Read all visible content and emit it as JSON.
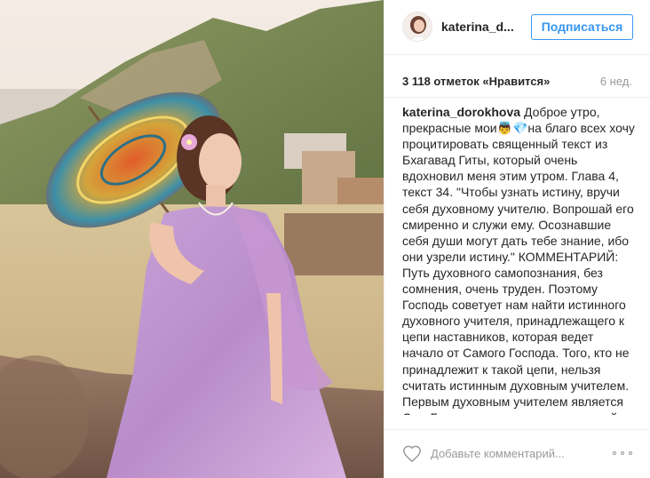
{
  "header": {
    "username": "katerina_d...",
    "follow_label": "Подписаться"
  },
  "meta": {
    "likes": "3 118 отметок «Нравится»",
    "age": "6 нед."
  },
  "caption": {
    "author": "katerina_dorokhova",
    "text": "Доброе утро, прекрасные мои👼💎на благо всех хочу процитировать священный текст из Бхагавад Гиты, который очень вдохновил меня этим утром. Глава 4, текст 34. \"Чтобы узнать истину, вручи себя духовному учителю. Вопрошай его смиренно и служи ему. Осознавшие себя души могут дать тебе знание, ибо они узрели истину.\" КОММЕНТАРИЙ: Путь духовного самопознания, без сомнения, очень труден. Поэтому Господь советует нам найти истинного духовного учителя, принадлежащего к цепи наставников, которая ведет начало от Самого Господа. Того, кто не принадлежит к такой цепи, нельзя считать истинным духовным учителем. Первым духовным учителем является Сам Господь, и человек, получивший это знание по цепи духовных учителей, способен передать своему ученику знание Господа в неискаженном виде."
  },
  "comment": {
    "placeholder": "Добавьте комментарий..."
  },
  "icons": {
    "like": "heart-outline-icon",
    "more": "more-options-icon"
  }
}
